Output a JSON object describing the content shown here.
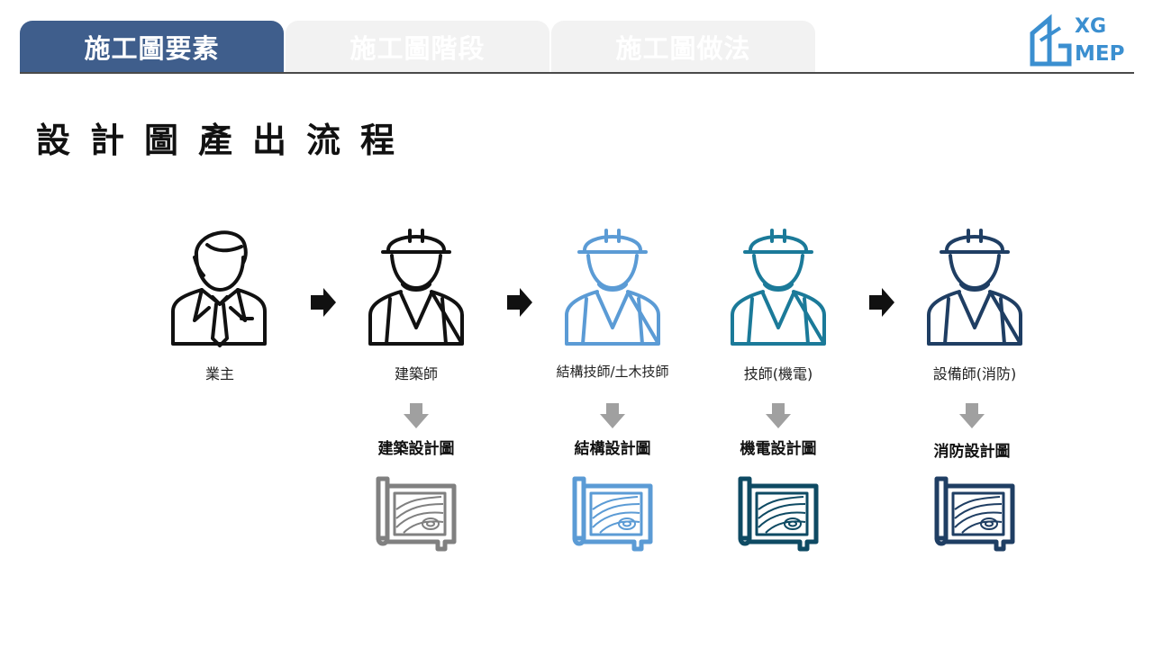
{
  "tabs": [
    {
      "label": "施工圖要素",
      "active": true
    },
    {
      "label": "施工圖階段",
      "active": false
    },
    {
      "label": "施工圖做法",
      "active": false
    }
  ],
  "logo": {
    "line1": "XG",
    "line2": "MEP",
    "color": "#3b8fd0"
  },
  "title": "設計圖產出流程",
  "roles": [
    {
      "label": "業主",
      "icon": "businessman-icon",
      "color": "#111111"
    },
    {
      "label": "建築師",
      "icon": "engineer-icon",
      "color": "#111111"
    },
    {
      "label": "結構技師/土木技師",
      "icon": "engineer-icon",
      "color": "#5b9bd5"
    },
    {
      "label": "技師(機電)",
      "icon": "engineer-icon",
      "color": "#1b7a99"
    },
    {
      "label": "設備師(消防)",
      "icon": "engineer-icon",
      "color": "#1f3e63"
    }
  ],
  "outputs": [
    {
      "label": "建築設計圖",
      "color": "#808080"
    },
    {
      "label": "結構設計圖",
      "color": "#5b9bd5"
    },
    {
      "label": "機電設計圖",
      "color": "#0e4a63"
    },
    {
      "label": "消防設計圖",
      "color": "#1f3e63"
    }
  ]
}
